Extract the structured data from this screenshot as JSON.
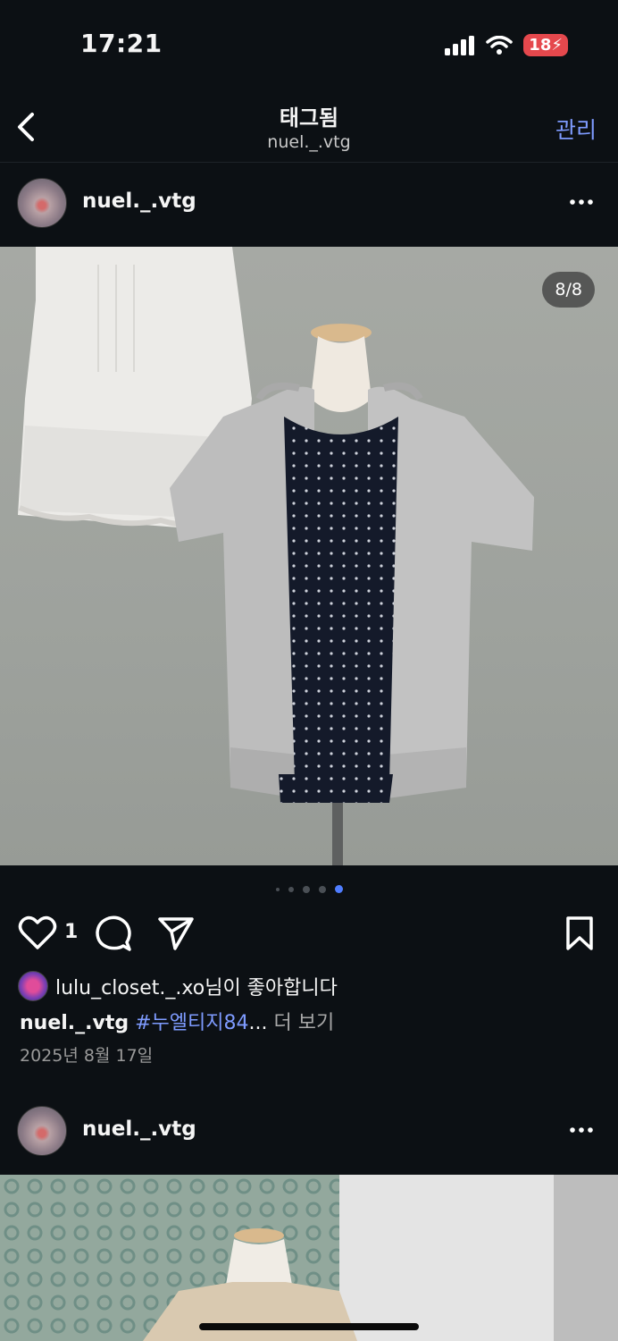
{
  "status": {
    "time": "17:21",
    "battery": "18"
  },
  "header": {
    "title": "태그됨",
    "subtitle": "nuel._.vtg",
    "manage": "관리"
  },
  "post1": {
    "username": "nuel._.vtg",
    "counter": "8/8",
    "like_count": "1",
    "liked_by_user": "lulu_closet._.xo",
    "liked_by_suffix": "님이 좋아합니다",
    "caption_user": "nuel._.vtg",
    "caption_tag": "#누엘티지84",
    "caption_ellipsis": "...",
    "caption_more": " 더 보기",
    "date": "2025년 8월 17일",
    "carousel_active_index": 5,
    "carousel_visible_dots": 5
  },
  "post2": {
    "username": "nuel._.vtg"
  },
  "colors": {
    "background": "#0c1014",
    "accent": "#7e9bff",
    "active_dot": "#4f7dff",
    "battery": "#e5484d"
  },
  "icons": [
    "back-chevron-icon",
    "more-icon",
    "heart-icon",
    "comment-icon",
    "send-icon",
    "bookmark-icon",
    "signal-icon",
    "wifi-icon"
  ]
}
